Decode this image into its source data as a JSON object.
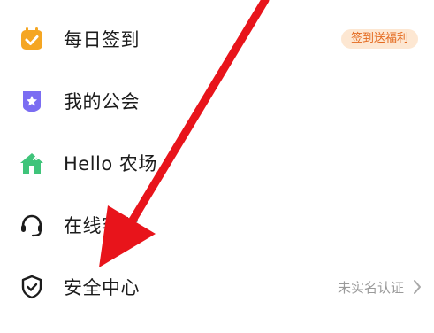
{
  "menu": {
    "items": [
      {
        "label": "每日签到",
        "icon": "calendar-check-icon",
        "badge": "签到送福利"
      },
      {
        "label": "我的公会",
        "icon": "star-badge-icon"
      },
      {
        "label": "Hello 农场",
        "icon": "farm-house-icon"
      },
      {
        "label": "在线客服",
        "icon": "headset-icon"
      },
      {
        "label": "安全中心",
        "icon": "shield-check-icon",
        "status": "未实名认证"
      }
    ]
  },
  "annotation": {
    "arrow_color": "#e8141b"
  },
  "colors": {
    "badge_bg": "#fde7d2",
    "badge_text": "#e46a1f",
    "calendar_icon": "#f5a623",
    "star_icon": "#7b6df2",
    "farm_icon": "#3fc47a",
    "muted_text": "#9a9a9a"
  }
}
